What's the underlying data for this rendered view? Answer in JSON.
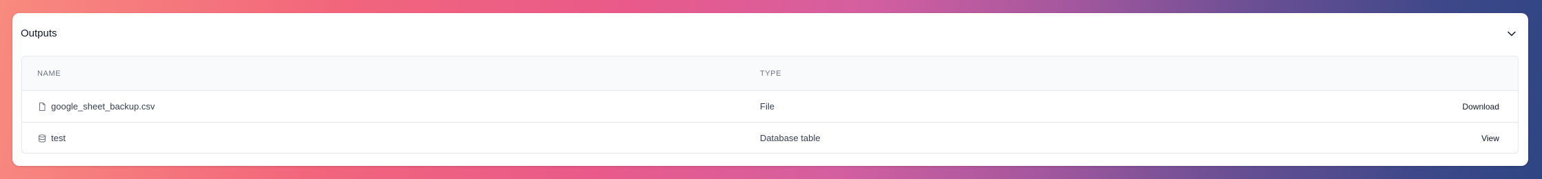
{
  "panel": {
    "title": "Outputs",
    "collapse_icon": "chevron-down-icon"
  },
  "table": {
    "headers": {
      "name": "NAME",
      "type": "TYPE"
    },
    "rows": [
      {
        "icon": "file-icon",
        "name": "google_sheet_backup.csv",
        "type": "File",
        "action": "Download"
      },
      {
        "icon": "database-icon",
        "name": "test",
        "type": "Database table",
        "action": "View"
      }
    ]
  },
  "colors": {
    "text_primary": "#111827",
    "text_secondary": "#374151",
    "header_text": "#6b7280",
    "border": "#e5e7eb",
    "header_bg": "#f9fafb"
  }
}
